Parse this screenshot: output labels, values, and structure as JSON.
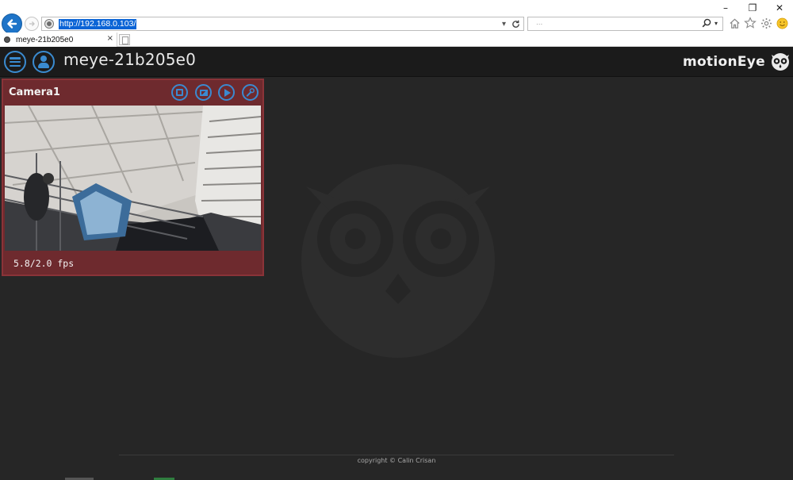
{
  "browser": {
    "window_controls": {
      "minimize": "–",
      "restore": "❐",
      "close": "✕"
    },
    "address": {
      "url": "http://192.168.0.103/"
    },
    "search": {
      "placeholder": "...",
      "search_icon": "search-icon"
    },
    "tab": {
      "label": "meye-21b205e0",
      "close": "×"
    },
    "toolbar_icons": [
      "home-icon",
      "favorites-star-icon",
      "settings-gear-icon",
      "smiley-feedback-icon"
    ]
  },
  "app": {
    "device_name": "meye-21b205e0",
    "brand": "motionEye",
    "accent_color": "#3a8bd0"
  },
  "camera": {
    "name": "Camera1",
    "fps": "5.8/2.0 fps",
    "frame_color": "#6e2a2e"
  },
  "footer": {
    "copyright": "copyright © Calin Crisan"
  }
}
